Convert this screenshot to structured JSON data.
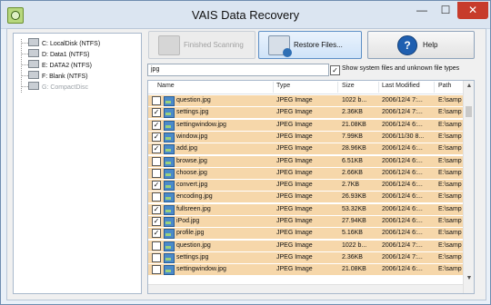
{
  "window": {
    "title": "VAIS Data Recovery",
    "minimize": "—",
    "maximize": "☐",
    "close": "✕"
  },
  "drives": [
    {
      "label": "C: LocalDisk (NTFS)",
      "enabled": true
    },
    {
      "label": "D: Data1 (NTFS)",
      "enabled": true
    },
    {
      "label": "E: DATA2 (NTFS)",
      "enabled": true
    },
    {
      "label": "F: Blank (NTFS)",
      "enabled": true
    },
    {
      "label": "G: CompactDisc",
      "enabled": false
    }
  ],
  "toolbar": {
    "finished_label": "Finished Scanning",
    "restore_label": "Restore Files...",
    "help_label": "Help",
    "help_glyph": "?"
  },
  "filter": {
    "value": "jpg",
    "show_label": "Show system files and unknown file types",
    "show_checked": true
  },
  "columns": {
    "name": "Name",
    "type": "Type",
    "size": "Size",
    "modified": "Last Modified",
    "path": "Path"
  },
  "files": [
    {
      "name": "question.jpg",
      "type": "JPEG Image",
      "size": "1022 b...",
      "modified": "2006/12/4 7:...",
      "path": "E:\\samp",
      "checked": false
    },
    {
      "name": "settings.jpg",
      "type": "JPEG Image",
      "size": "2.36KB",
      "modified": "2006/12/4 7:...",
      "path": "E:\\samp",
      "checked": true
    },
    {
      "name": "settingwindow.jpg",
      "type": "JPEG Image",
      "size": "21.08KB",
      "modified": "2006/12/4 6:...",
      "path": "E:\\samp",
      "checked": true
    },
    {
      "name": "window.jpg",
      "type": "JPEG Image",
      "size": "7.99KB",
      "modified": "2006/11/30 8...",
      "path": "E:\\samp",
      "checked": true
    },
    {
      "name": "add.jpg",
      "type": "JPEG Image",
      "size": "28.96KB",
      "modified": "2006/12/4 6:...",
      "path": "E:\\samp",
      "checked": true
    },
    {
      "name": "browse.jpg",
      "type": "JPEG Image",
      "size": "6.51KB",
      "modified": "2006/12/4 6:...",
      "path": "E:\\samp",
      "checked": false
    },
    {
      "name": "choose.jpg",
      "type": "JPEG Image",
      "size": "2.66KB",
      "modified": "2006/12/4 6:...",
      "path": "E:\\samp",
      "checked": false
    },
    {
      "name": "convert.jpg",
      "type": "JPEG Image",
      "size": "2.7KB",
      "modified": "2006/12/4 6:...",
      "path": "E:\\samp",
      "checked": true
    },
    {
      "name": "encoding.jpg",
      "type": "JPEG Image",
      "size": "26.93KB",
      "modified": "2006/12/4 6:...",
      "path": "E:\\samp",
      "checked": false
    },
    {
      "name": "fullsreen.jpg",
      "type": "JPEG Image",
      "size": "53.32KB",
      "modified": "2006/12/4 6:...",
      "path": "E:\\samp",
      "checked": true
    },
    {
      "name": "iPod.jpg",
      "type": "JPEG Image",
      "size": "27.94KB",
      "modified": "2006/12/4 6:...",
      "path": "E:\\samp",
      "checked": true
    },
    {
      "name": "profile.jpg",
      "type": "JPEG Image",
      "size": "5.16KB",
      "modified": "2006/12/4 6:...",
      "path": "E:\\samp",
      "checked": true
    },
    {
      "name": "question.jpg",
      "type": "JPEG Image",
      "size": "1022 b...",
      "modified": "2006/12/4 7:...",
      "path": "E:\\samp",
      "checked": false
    },
    {
      "name": "settings.jpg",
      "type": "JPEG Image",
      "size": "2.36KB",
      "modified": "2006/12/4 7:...",
      "path": "E:\\samp",
      "checked": false
    },
    {
      "name": "settingwindow.jpg",
      "type": "JPEG Image",
      "size": "21.08KB",
      "modified": "2006/12/4 6:...",
      "path": "E:\\samp",
      "checked": false
    }
  ]
}
